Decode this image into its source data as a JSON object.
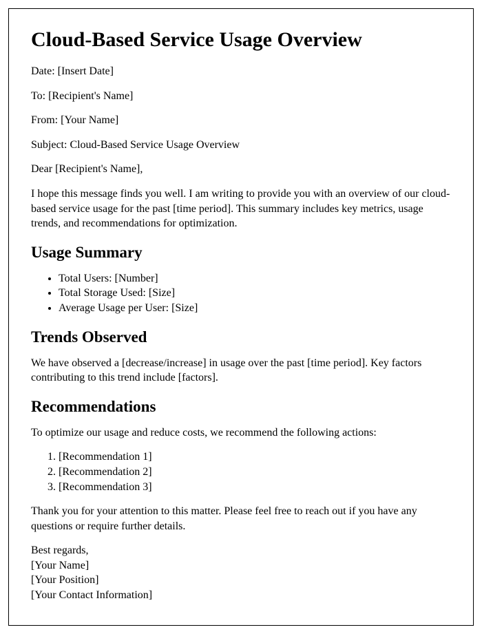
{
  "title": "Cloud-Based Service Usage Overview",
  "meta": {
    "date": "Date: [Insert Date]",
    "to": "To: [Recipient's Name]",
    "from": "From: [Your Name]",
    "subject": "Subject: Cloud-Based Service Usage Overview"
  },
  "salutation": "Dear [Recipient's Name],",
  "intro": "I hope this message finds you well. I am writing to provide you with an overview of our cloud-based service usage for the past [time period]. This summary includes key metrics, usage trends, and recommendations for optimization.",
  "sections": {
    "usage_summary": {
      "heading": "Usage Summary",
      "items": [
        "Total Users: [Number]",
        "Total Storage Used: [Size]",
        "Average Usage per User: [Size]"
      ]
    },
    "trends": {
      "heading": "Trends Observed",
      "body": "We have observed a [decrease/increase] in usage over the past [time period]. Key factors contributing to this trend include [factors]."
    },
    "recommendations": {
      "heading": "Recommendations",
      "intro": "To optimize our usage and reduce costs, we recommend the following actions:",
      "items": [
        "[Recommendation 1]",
        "[Recommendation 2]",
        "[Recommendation 3]"
      ]
    }
  },
  "closing": "Thank you for your attention to this matter. Please feel free to reach out if you have any questions or require further details.",
  "signoff": {
    "regards": "Best regards,",
    "name": "[Your Name]",
    "position": "[Your Position]",
    "contact": "[Your Contact Information]"
  }
}
